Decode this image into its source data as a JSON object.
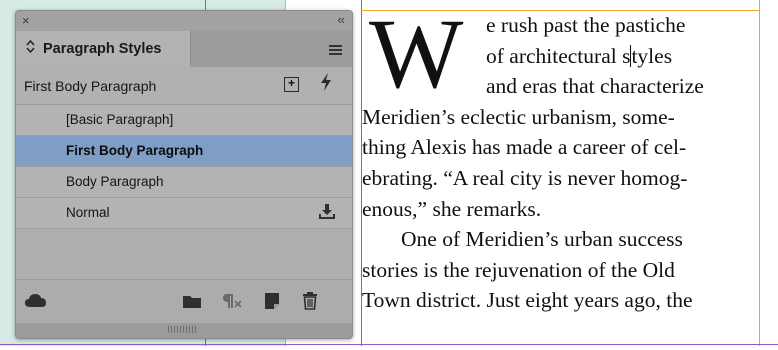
{
  "panel": {
    "close_glyph": "×",
    "collapse_glyph": "‹‹",
    "tab_label": "Paragraph Styles",
    "current_style": "First Body Paragraph",
    "styles": [
      {
        "label": "[Basic Paragraph]",
        "selected": false
      },
      {
        "label": "First Body Paragraph",
        "selected": true
      },
      {
        "label": "Body Paragraph",
        "selected": false
      },
      {
        "label": "Normal",
        "selected": false
      }
    ],
    "selection_color": "#7f9ec5"
  },
  "document": {
    "drop_cap": "W",
    "drop_cap_lines": [
      "e rush past the pastiche",
      "of architectural s",
      "and eras that characterize"
    ],
    "caret_after": "tyles",
    "body_lines": [
      "Meridien’s eclectic urbanism, some-",
      "thing Alexis has made a career of cel-",
      "ebrating. “A real city is never homog-",
      "enous,” she remarks.",
      "One of Meridien’s urban success",
      "stories is the rejuvenation of the Old",
      "Town district. Just eight years ago, the"
    ]
  },
  "colors": {
    "guide_purple": "#8a5cc8",
    "guide_orange": "#f2a51f",
    "pasteboard_tint": "#d6ebe6"
  }
}
